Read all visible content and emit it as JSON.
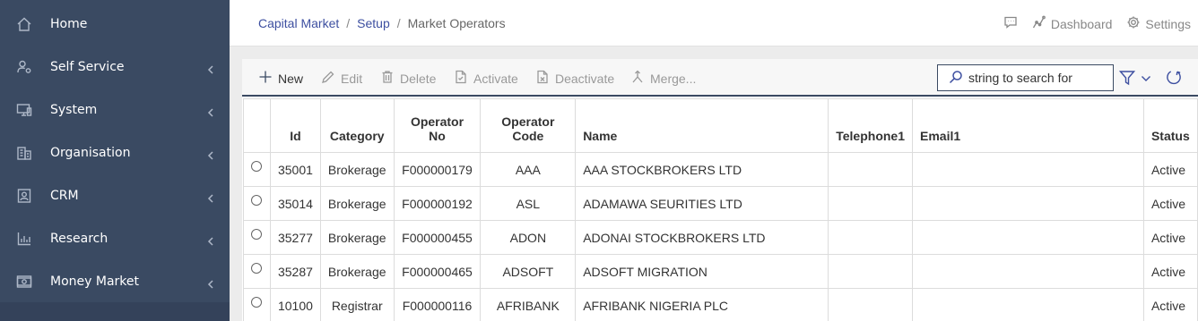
{
  "sidebar": {
    "items": [
      {
        "label": "Home",
        "icon": "home-icon",
        "has_children": false
      },
      {
        "label": "Self Service",
        "icon": "user-gear-icon",
        "has_children": true
      },
      {
        "label": "System",
        "icon": "monitor-icon",
        "has_children": true
      },
      {
        "label": "Organisation",
        "icon": "building-icon",
        "has_children": true
      },
      {
        "label": "CRM",
        "icon": "contact-icon",
        "has_children": true
      },
      {
        "label": "Research",
        "icon": "bar-chart-icon",
        "has_children": true
      },
      {
        "label": "Money Market",
        "icon": "money-icon",
        "has_children": true
      }
    ],
    "colors": {
      "background": "#3a4a62",
      "icon": "#aeb8c8"
    }
  },
  "header": {
    "breadcrumb": [
      {
        "label": "Capital Market",
        "link": true
      },
      {
        "label": "Setup",
        "link": true
      },
      {
        "label": "Market Operators",
        "link": false
      }
    ],
    "separator": "/",
    "actions": [
      {
        "label": "",
        "icon": "comment-icon"
      },
      {
        "label": "Dashboard",
        "icon": "dashboard-icon"
      },
      {
        "label": "Settings",
        "icon": "gear-icon"
      }
    ]
  },
  "toolbar": {
    "new_label": "New",
    "edit_label": "Edit",
    "delete_label": "Delete",
    "activate_label": "Activate",
    "deactivate_label": "Deactivate",
    "merge_label": "Merge...",
    "search_placeholder": "string to search for"
  },
  "table": {
    "columns": [
      "",
      "Id",
      "Category",
      "Operator No",
      "Operator Code",
      "Name",
      "Telephone1",
      "Email1",
      "Status"
    ],
    "column_header_lines": {
      "operator_no": [
        "Operator",
        "No"
      ],
      "operator_code": [
        "Operator",
        "Code"
      ]
    },
    "rows": [
      {
        "id": "35001",
        "category": "Brokerage",
        "operator_no": "F000000179",
        "operator_code": "AAA",
        "name": "AAA STOCKBROKERS LTD",
        "telephone1": "",
        "email1": "",
        "status": "Active"
      },
      {
        "id": "35014",
        "category": "Brokerage",
        "operator_no": "F000000192",
        "operator_code": "ASL",
        "name": "ADAMAWA SEURITIES LTD",
        "telephone1": "",
        "email1": "",
        "status": "Active"
      },
      {
        "id": "35277",
        "category": "Brokerage",
        "operator_no": "F000000455",
        "operator_code": "ADON",
        "name": "ADONAI STOCKBROKERS LTD",
        "telephone1": "",
        "email1": "",
        "status": "Active"
      },
      {
        "id": "35287",
        "category": "Brokerage",
        "operator_no": "F000000465",
        "operator_code": "ADSOFT",
        "name": "ADSOFT MIGRATION",
        "telephone1": "",
        "email1": "",
        "status": "Active"
      },
      {
        "id": "10100",
        "category": "Registrar",
        "operator_no": "F000000116",
        "operator_code": "AFRIBANK",
        "name": "AFRIBANK NIGERIA PLC",
        "telephone1": "",
        "email1": "",
        "status": "Active"
      }
    ]
  },
  "colors": {
    "accent": "#3d4fa0",
    "dark": "#3a4a62"
  }
}
